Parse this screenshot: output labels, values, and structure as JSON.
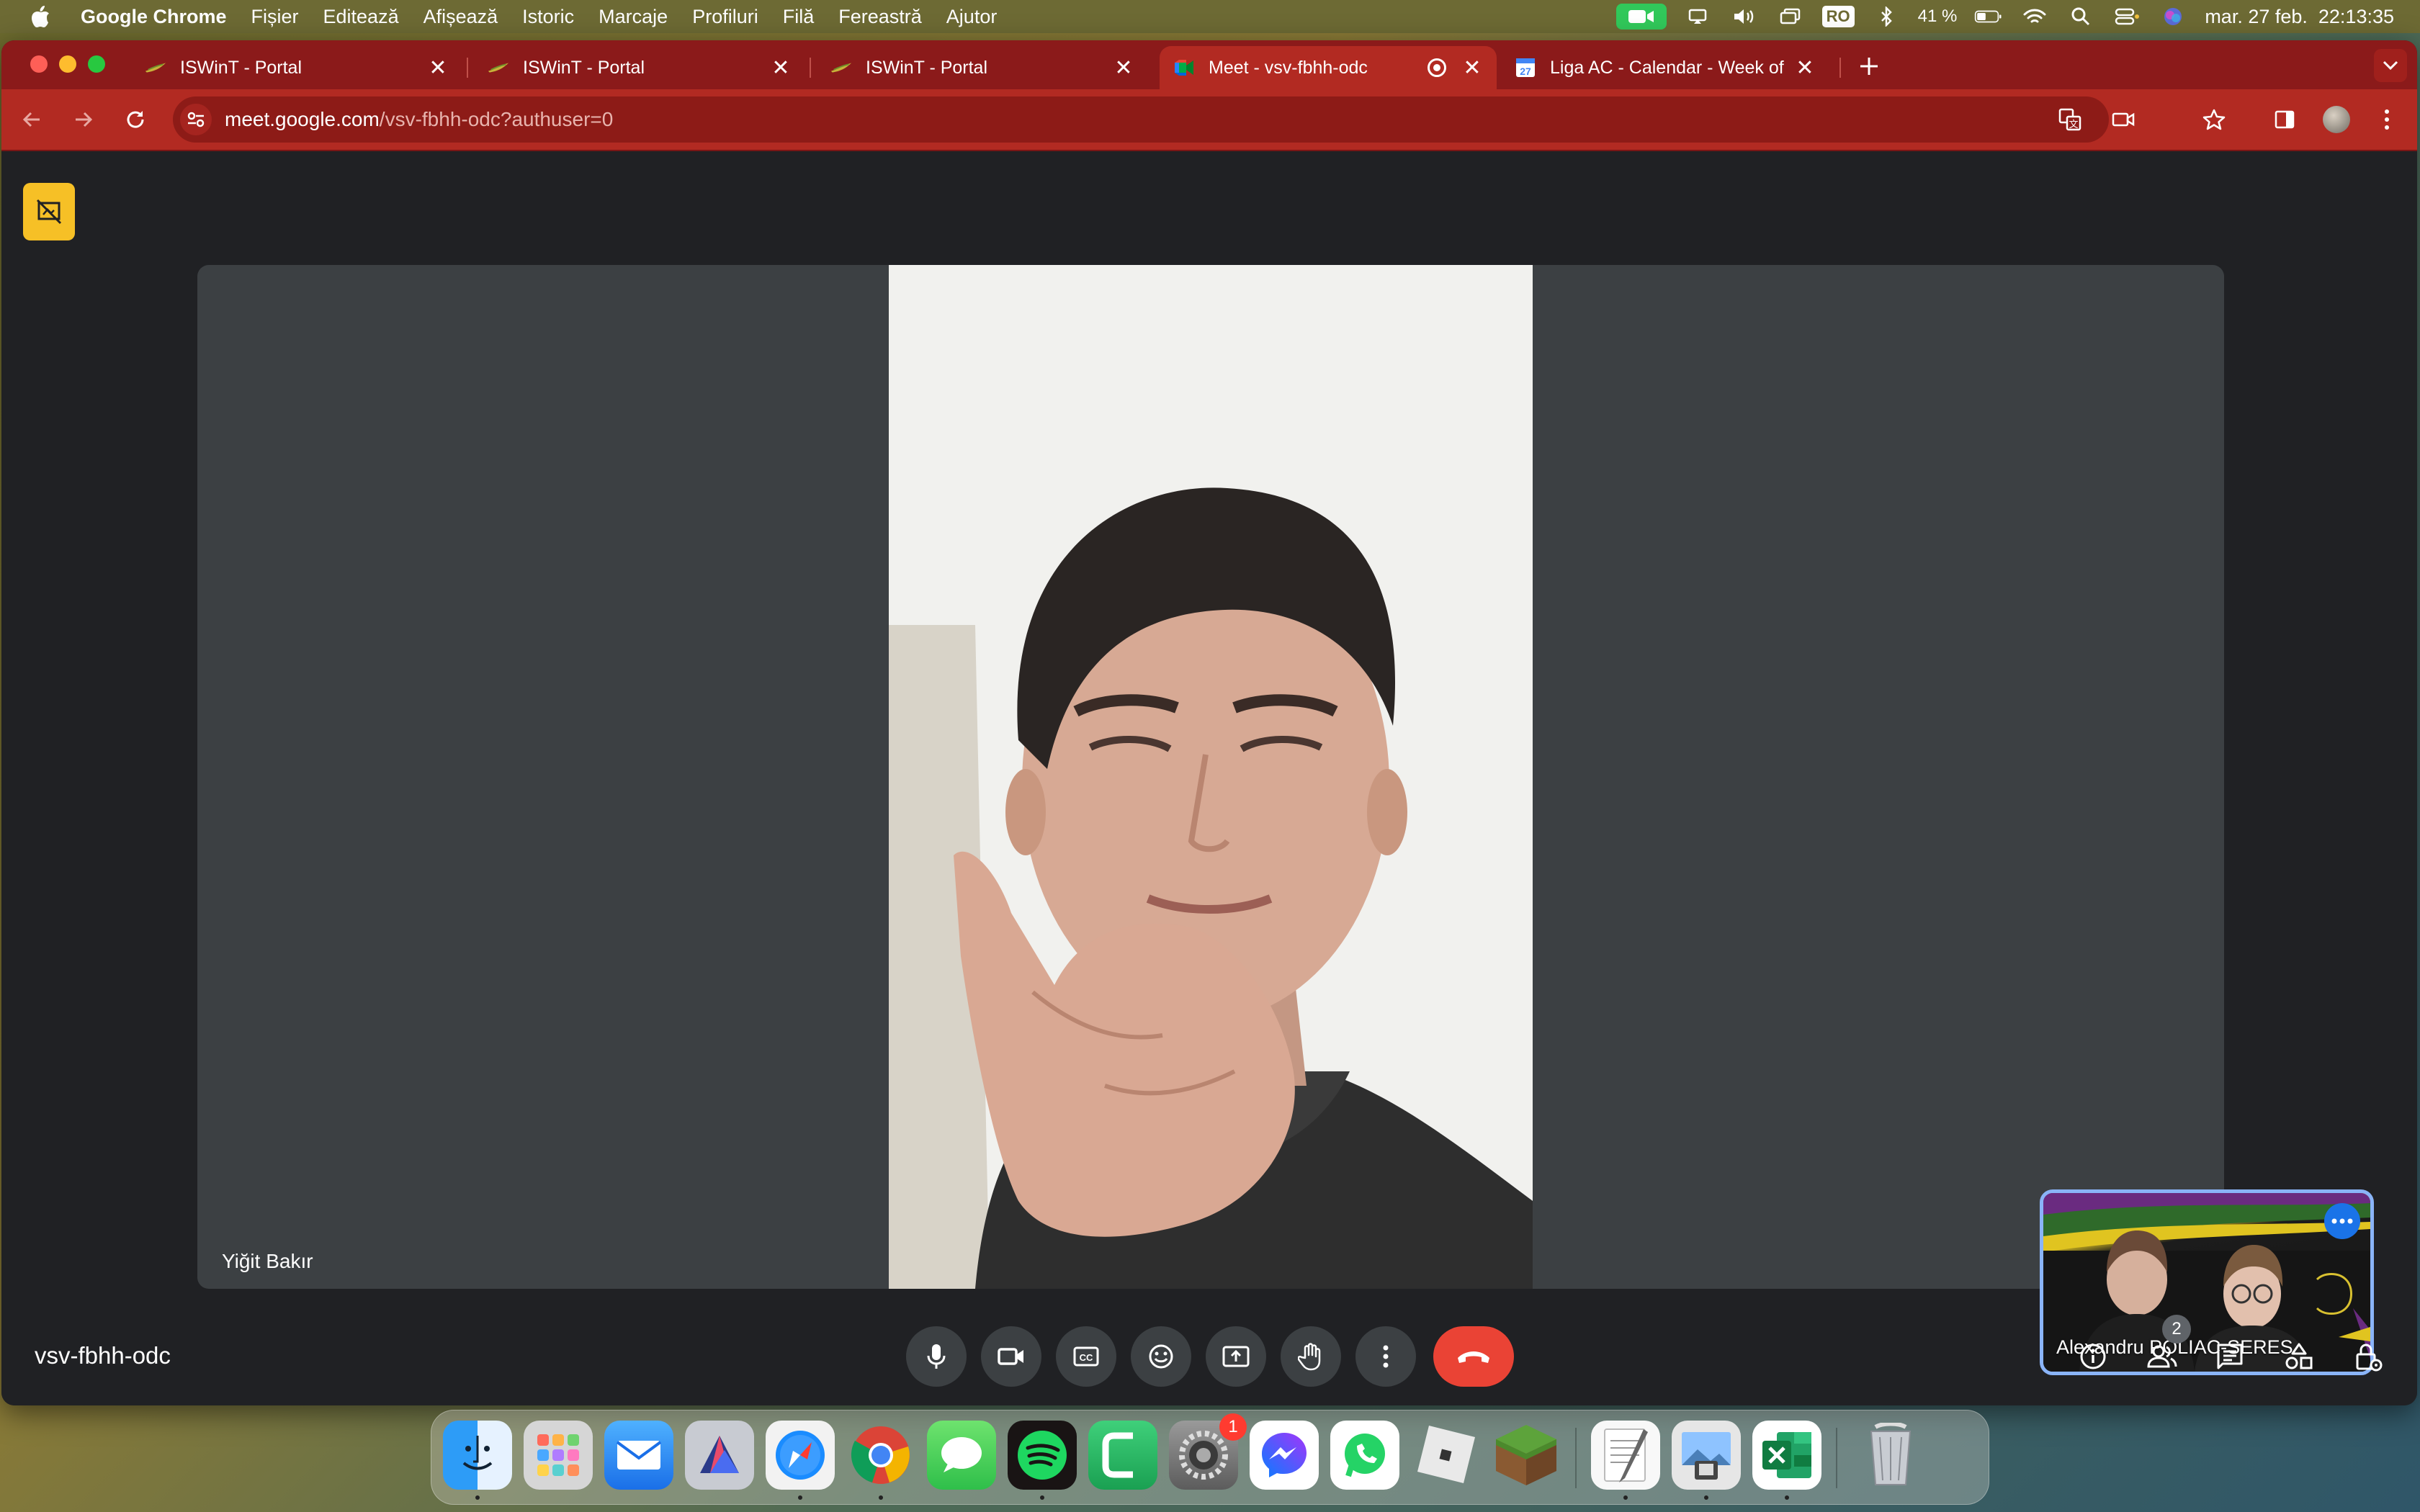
{
  "menubar": {
    "app_name": "Google Chrome",
    "items": [
      "Fișier",
      "Editează",
      "Afișează",
      "Istoric",
      "Marcaje",
      "Profiluri",
      "Filă",
      "Fereastră",
      "Ajutor"
    ],
    "input_source": "RO",
    "battery": "41 %",
    "clock": "mar. 27 feb.  22:13:35"
  },
  "tabs": [
    {
      "title": "ISWinT - Portal",
      "favicon": "iswint-favicon-icon",
      "active": false
    },
    {
      "title": "ISWinT - Portal",
      "favicon": "iswint-favicon-icon",
      "active": false
    },
    {
      "title": "ISWinT - Portal",
      "favicon": "iswint-favicon-icon",
      "active": false
    },
    {
      "title": "Meet - vsv-fbhh-odc",
      "favicon": "google-meet-favicon-icon",
      "active": true,
      "recording": true
    },
    {
      "title": "Liga AC - Calendar - Week of",
      "favicon": "google-calendar-favicon-icon",
      "active": false
    }
  ],
  "omnibox": {
    "domain": "meet.google.com",
    "path": "/vsv-fbhh-odc?authuser=0"
  },
  "meet": {
    "main_participant": "Yiğit Bakır",
    "self_participant": "Alexandru POLIAC-SERES",
    "meeting_code": "vsv-fbhh-odc",
    "people_count": "2"
  },
  "colors": {
    "tab_strip": "#8b1a1a",
    "toolbar": "#b22a22",
    "meet_background": "#202124",
    "tile_background": "#3c4043",
    "end_call": "#ea4335",
    "self_tile_border": "#8ab4f8",
    "layout_badge": "#f6c026"
  },
  "dock": {
    "apps": [
      "finder-icon",
      "launchpad-icon",
      "mail-icon",
      "affinity-icon",
      "safari-icon",
      "chrome-icon",
      "messages-icon",
      "spotify-icon",
      "camo-icon",
      "system-settings-icon",
      "messenger-icon",
      "whatsapp-icon",
      "roblox-icon",
      "minecraft-icon",
      "textedit-icon",
      "preview-icon",
      "excel-icon",
      "trash-icon"
    ],
    "settings_badge": "1"
  }
}
